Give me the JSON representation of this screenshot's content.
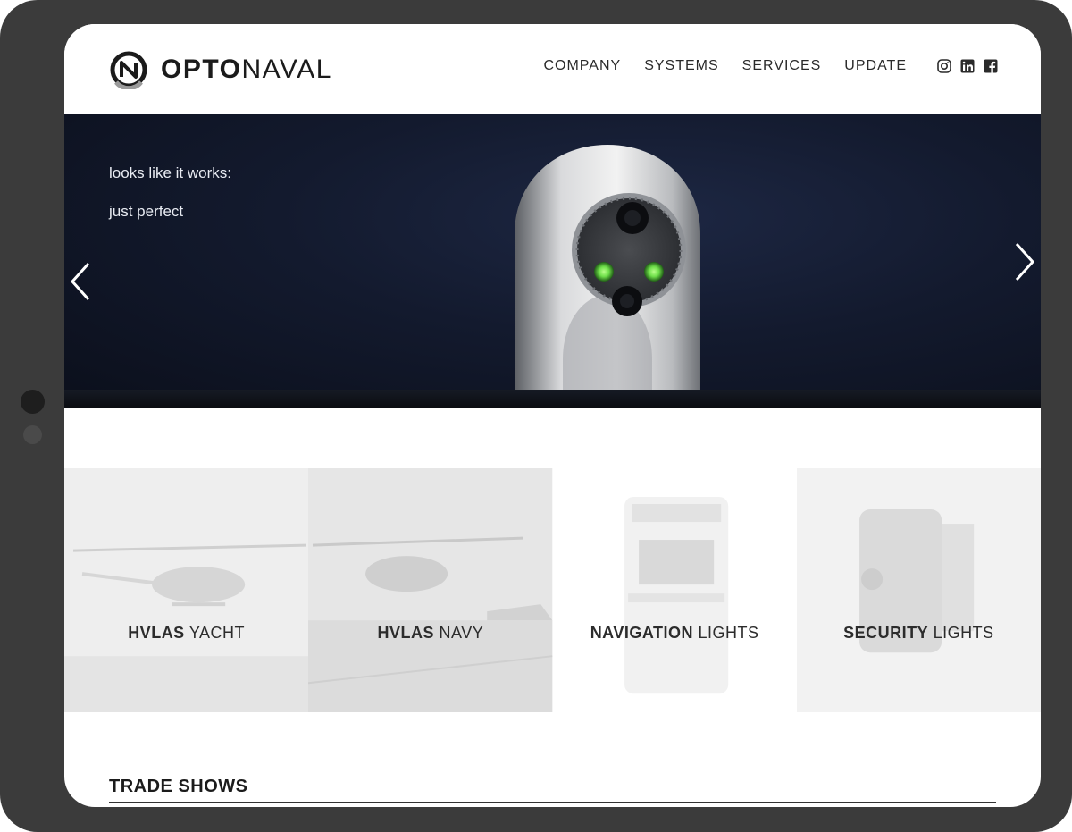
{
  "brand": {
    "name_bold": "OPTO",
    "name_light": "NAVAL"
  },
  "nav": {
    "items": [
      {
        "label": "COMPANY"
      },
      {
        "label": "SYSTEMS"
      },
      {
        "label": "SERVICES"
      },
      {
        "label": "UPDATE"
      }
    ]
  },
  "social": {
    "icons": [
      "instagram-icon",
      "linkedin-icon",
      "facebook-icon"
    ]
  },
  "hero": {
    "line1": "looks like it works:",
    "line2": "just perfect",
    "prev_icon": "chevron-left-icon",
    "next_icon": "chevron-right-icon"
  },
  "tiles": [
    {
      "bold": "HVLAS",
      "light": " YACHT"
    },
    {
      "bold": "HVLAS",
      "light": " NAVY"
    },
    {
      "bold": "NAVIGATION",
      "light": " LIGHTS"
    },
    {
      "bold": "SECURITY",
      "light": " LIGHTS"
    }
  ],
  "sections": {
    "trade_shows": "TRADE SHOWS"
  },
  "colors": {
    "frame": "#3b3b3b",
    "hero_bg": "#131a2e",
    "accent_green": "#6fe04a",
    "text": "#2a2a2a"
  }
}
